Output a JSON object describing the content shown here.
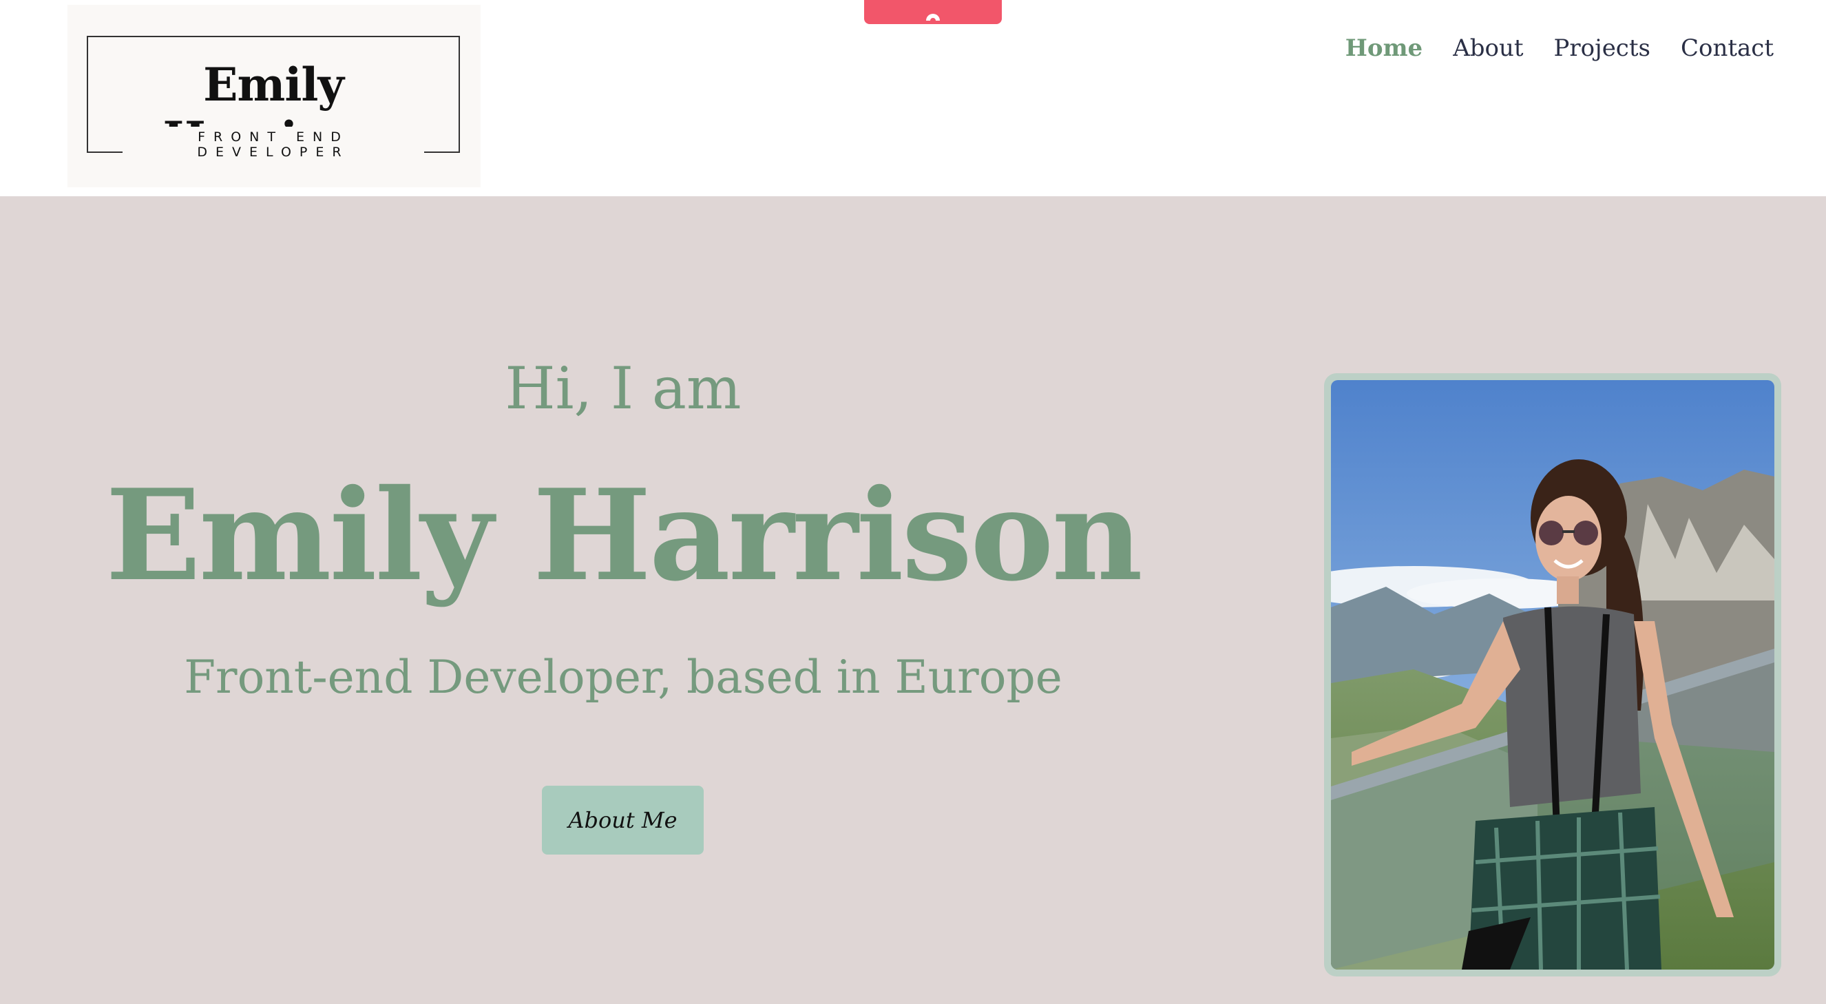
{
  "logo": {
    "name": "Emily Harrison",
    "subtitle": "FRONT END DEVELOPER"
  },
  "nav": {
    "items": [
      {
        "label": "Home",
        "active": true
      },
      {
        "label": "About",
        "active": false
      },
      {
        "label": "Projects",
        "active": false
      },
      {
        "label": "Contact",
        "active": false
      }
    ]
  },
  "hero": {
    "greeting": "Hi, I am",
    "name": "Emily Harrison",
    "tagline": "Front-end Developer, based in Europe",
    "button_label": "About Me"
  },
  "colors": {
    "accent_green": "#759a7e",
    "hero_bg": "#dfd6d5",
    "button_bg": "#a8cbbd",
    "top_tab": "#f2566a"
  },
  "icons": {
    "top_tab_icon": "chevron-up-icon"
  }
}
